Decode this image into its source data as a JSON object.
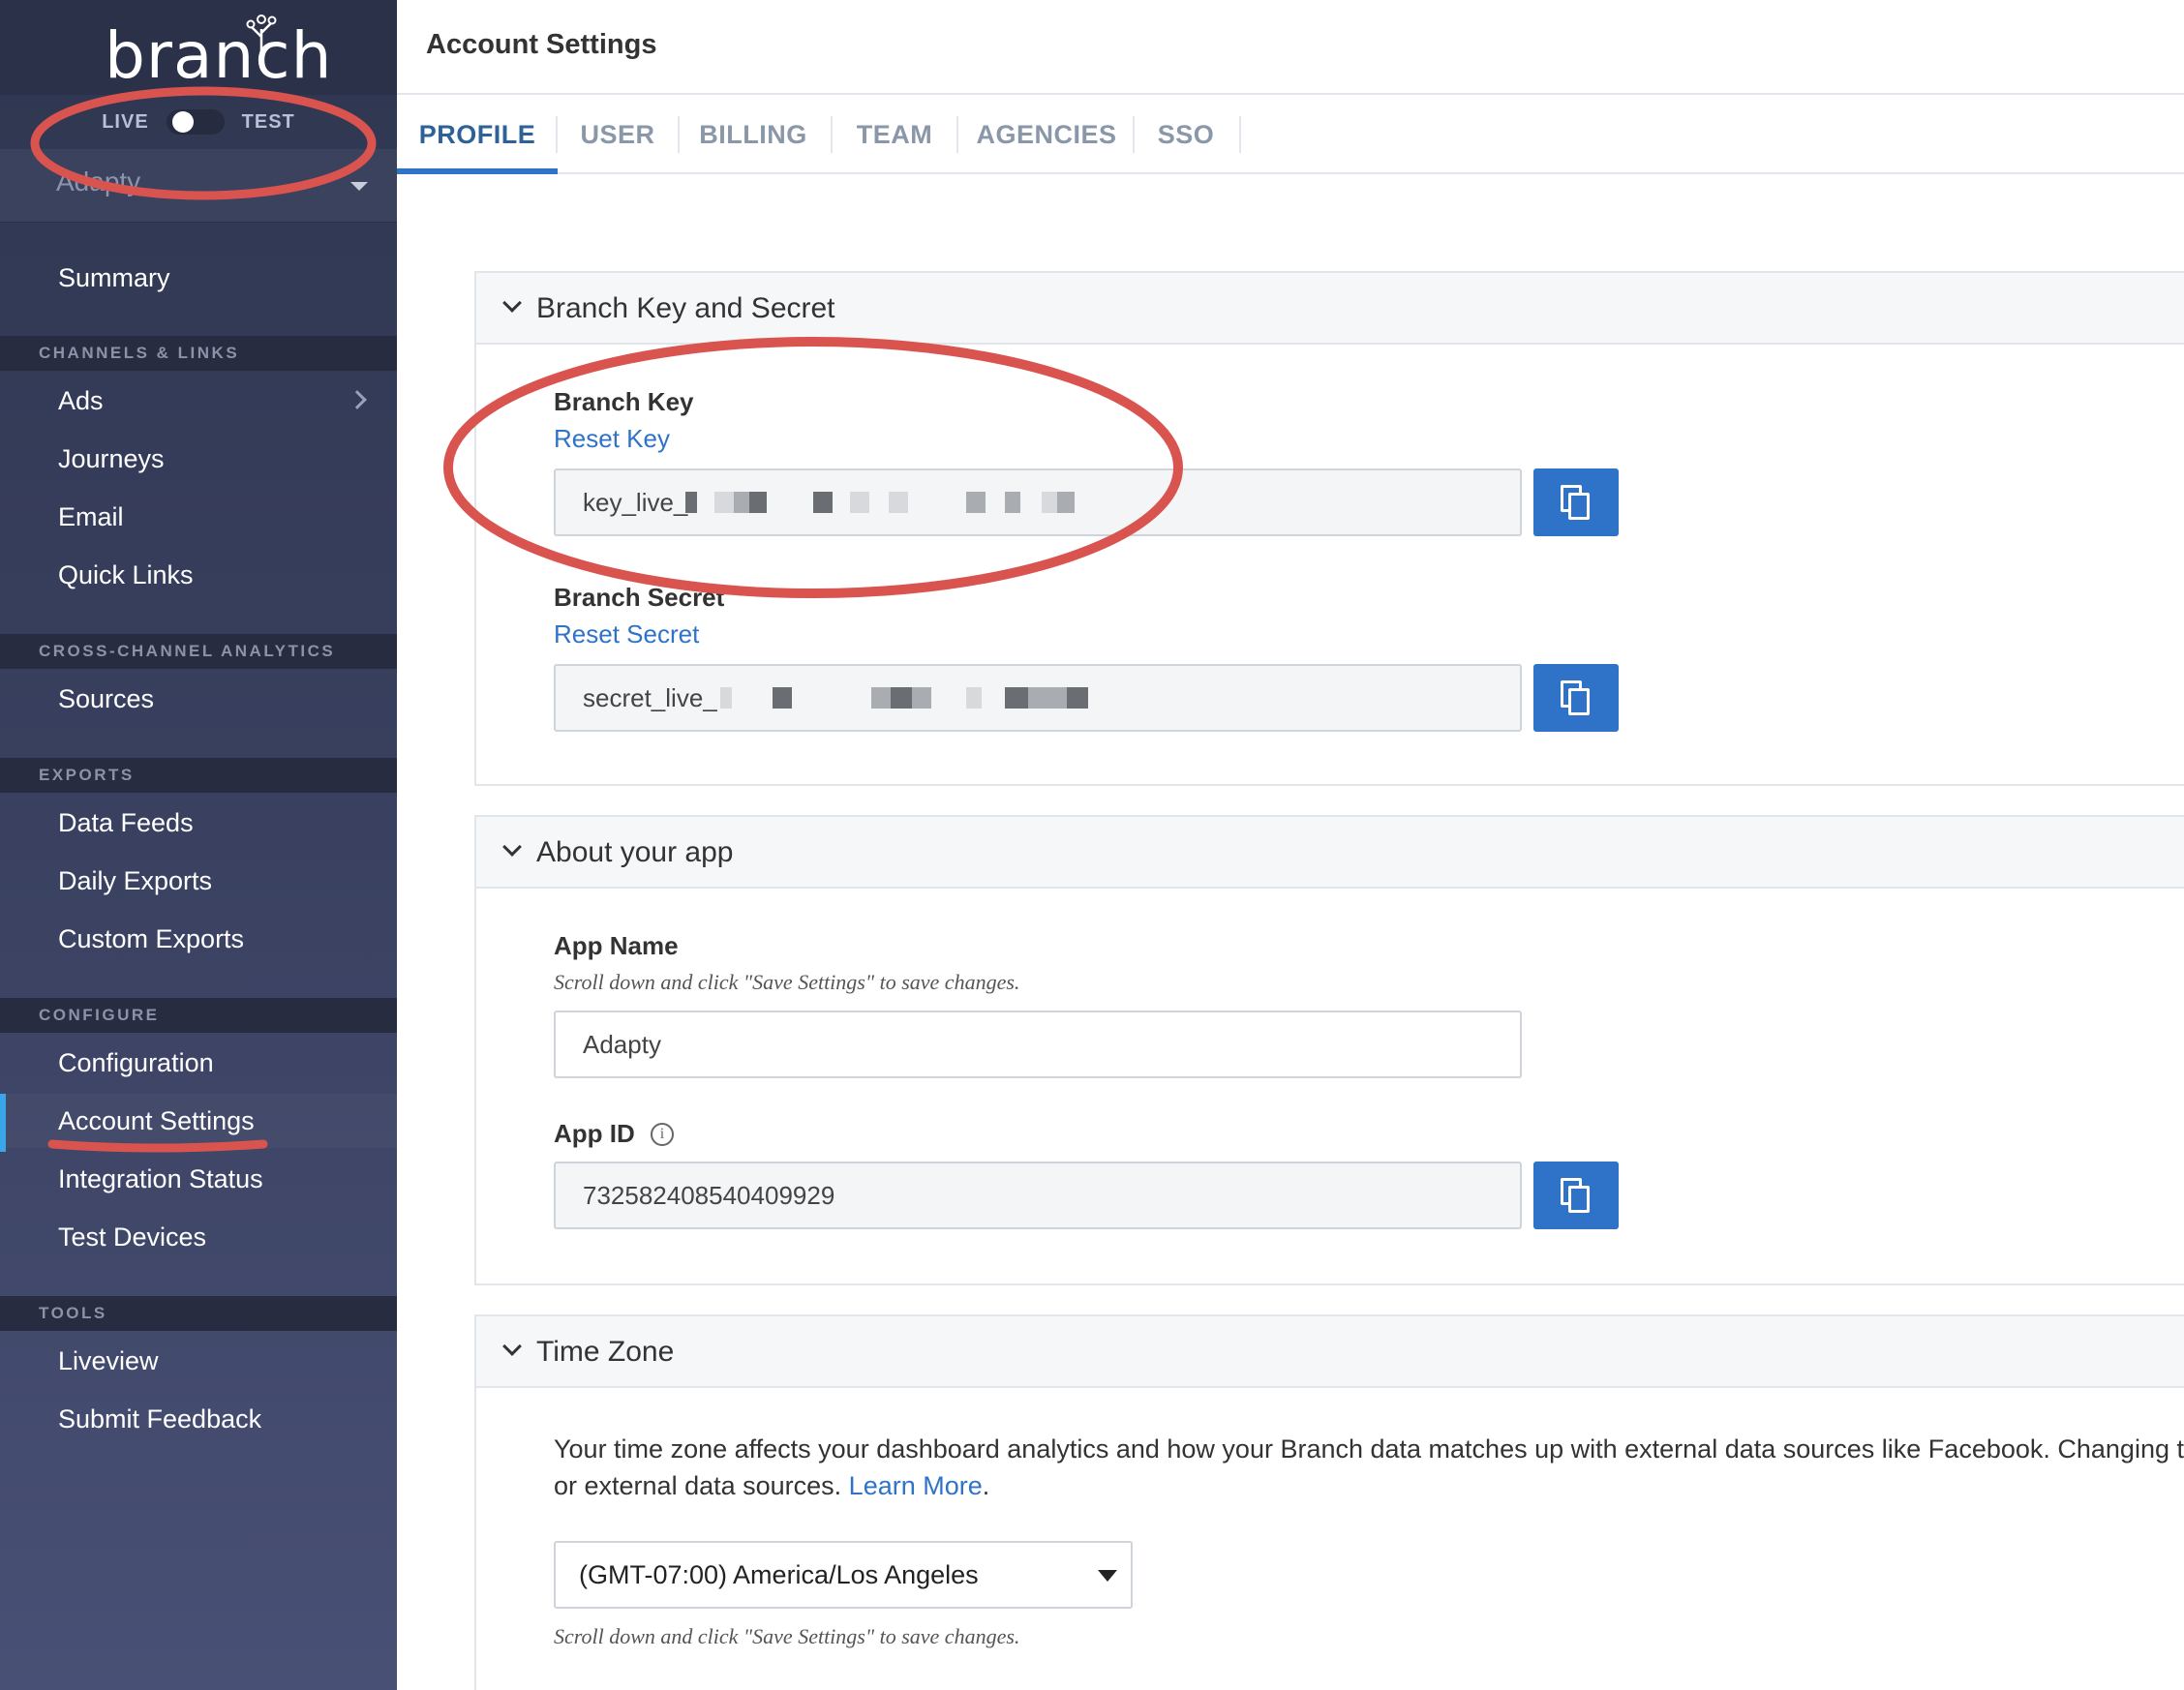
{
  "brand": {
    "logo": "branch"
  },
  "env": {
    "live_label": "LIVE",
    "test_label": "TEST"
  },
  "org": {
    "name": "Adapty"
  },
  "sidebar": {
    "summary": "Summary",
    "sections": {
      "channels": "CHANNELS & LINKS",
      "analytics": "CROSS-CHANNEL ANALYTICS",
      "exports": "EXPORTS",
      "configure": "CONFIGURE",
      "tools": "TOOLS"
    },
    "items": {
      "ads": "Ads",
      "journeys": "Journeys",
      "email": "Email",
      "quick_links": "Quick Links",
      "sources": "Sources",
      "data_feeds": "Data Feeds",
      "daily_exports": "Daily Exports",
      "custom_exports": "Custom Exports",
      "configuration": "Configuration",
      "account_settings": "Account Settings",
      "integration_status": "Integration Status",
      "test_devices": "Test Devices",
      "liveview": "Liveview",
      "submit_feedback": "Submit Feedback"
    }
  },
  "header": {
    "title": "Account Settings"
  },
  "tabs": [
    "PROFILE",
    "USER",
    "BILLING",
    "TEAM",
    "AGENCIES",
    "SSO"
  ],
  "key_panel": {
    "title": "Branch Key and Secret",
    "key_label": "Branch Key",
    "reset_key": "Reset Key",
    "key_value": "key_live_",
    "secret_label": "Branch Secret",
    "reset_secret": "Reset Secret",
    "secret_value": "secret_live_"
  },
  "app_panel": {
    "title": "About your app",
    "name_label": "App Name",
    "name_hint": "Scroll down and click \"Save Settings\" to save changes.",
    "name_value": "Adapty",
    "id_label": "App ID",
    "id_info": "i",
    "id_value": "732582408540409929"
  },
  "tz_panel": {
    "title": "Time Zone",
    "desc_line1": "Your time zone affects your dashboard analytics and how your Branch data matches up with external data sources like Facebook. Changing time z",
    "desc_line2_prefix": "or external data sources. ",
    "learn_more": "Learn More",
    "desc_line2_suffix": ".",
    "selected": "(GMT-07:00) America/Los Angeles",
    "hint": "Scroll down and click \"Save Settings\" to save changes."
  },
  "colors": {
    "sidebar_bg": "#3b4262",
    "accent": "#2f73c8",
    "annotation": "#d9534f"
  }
}
